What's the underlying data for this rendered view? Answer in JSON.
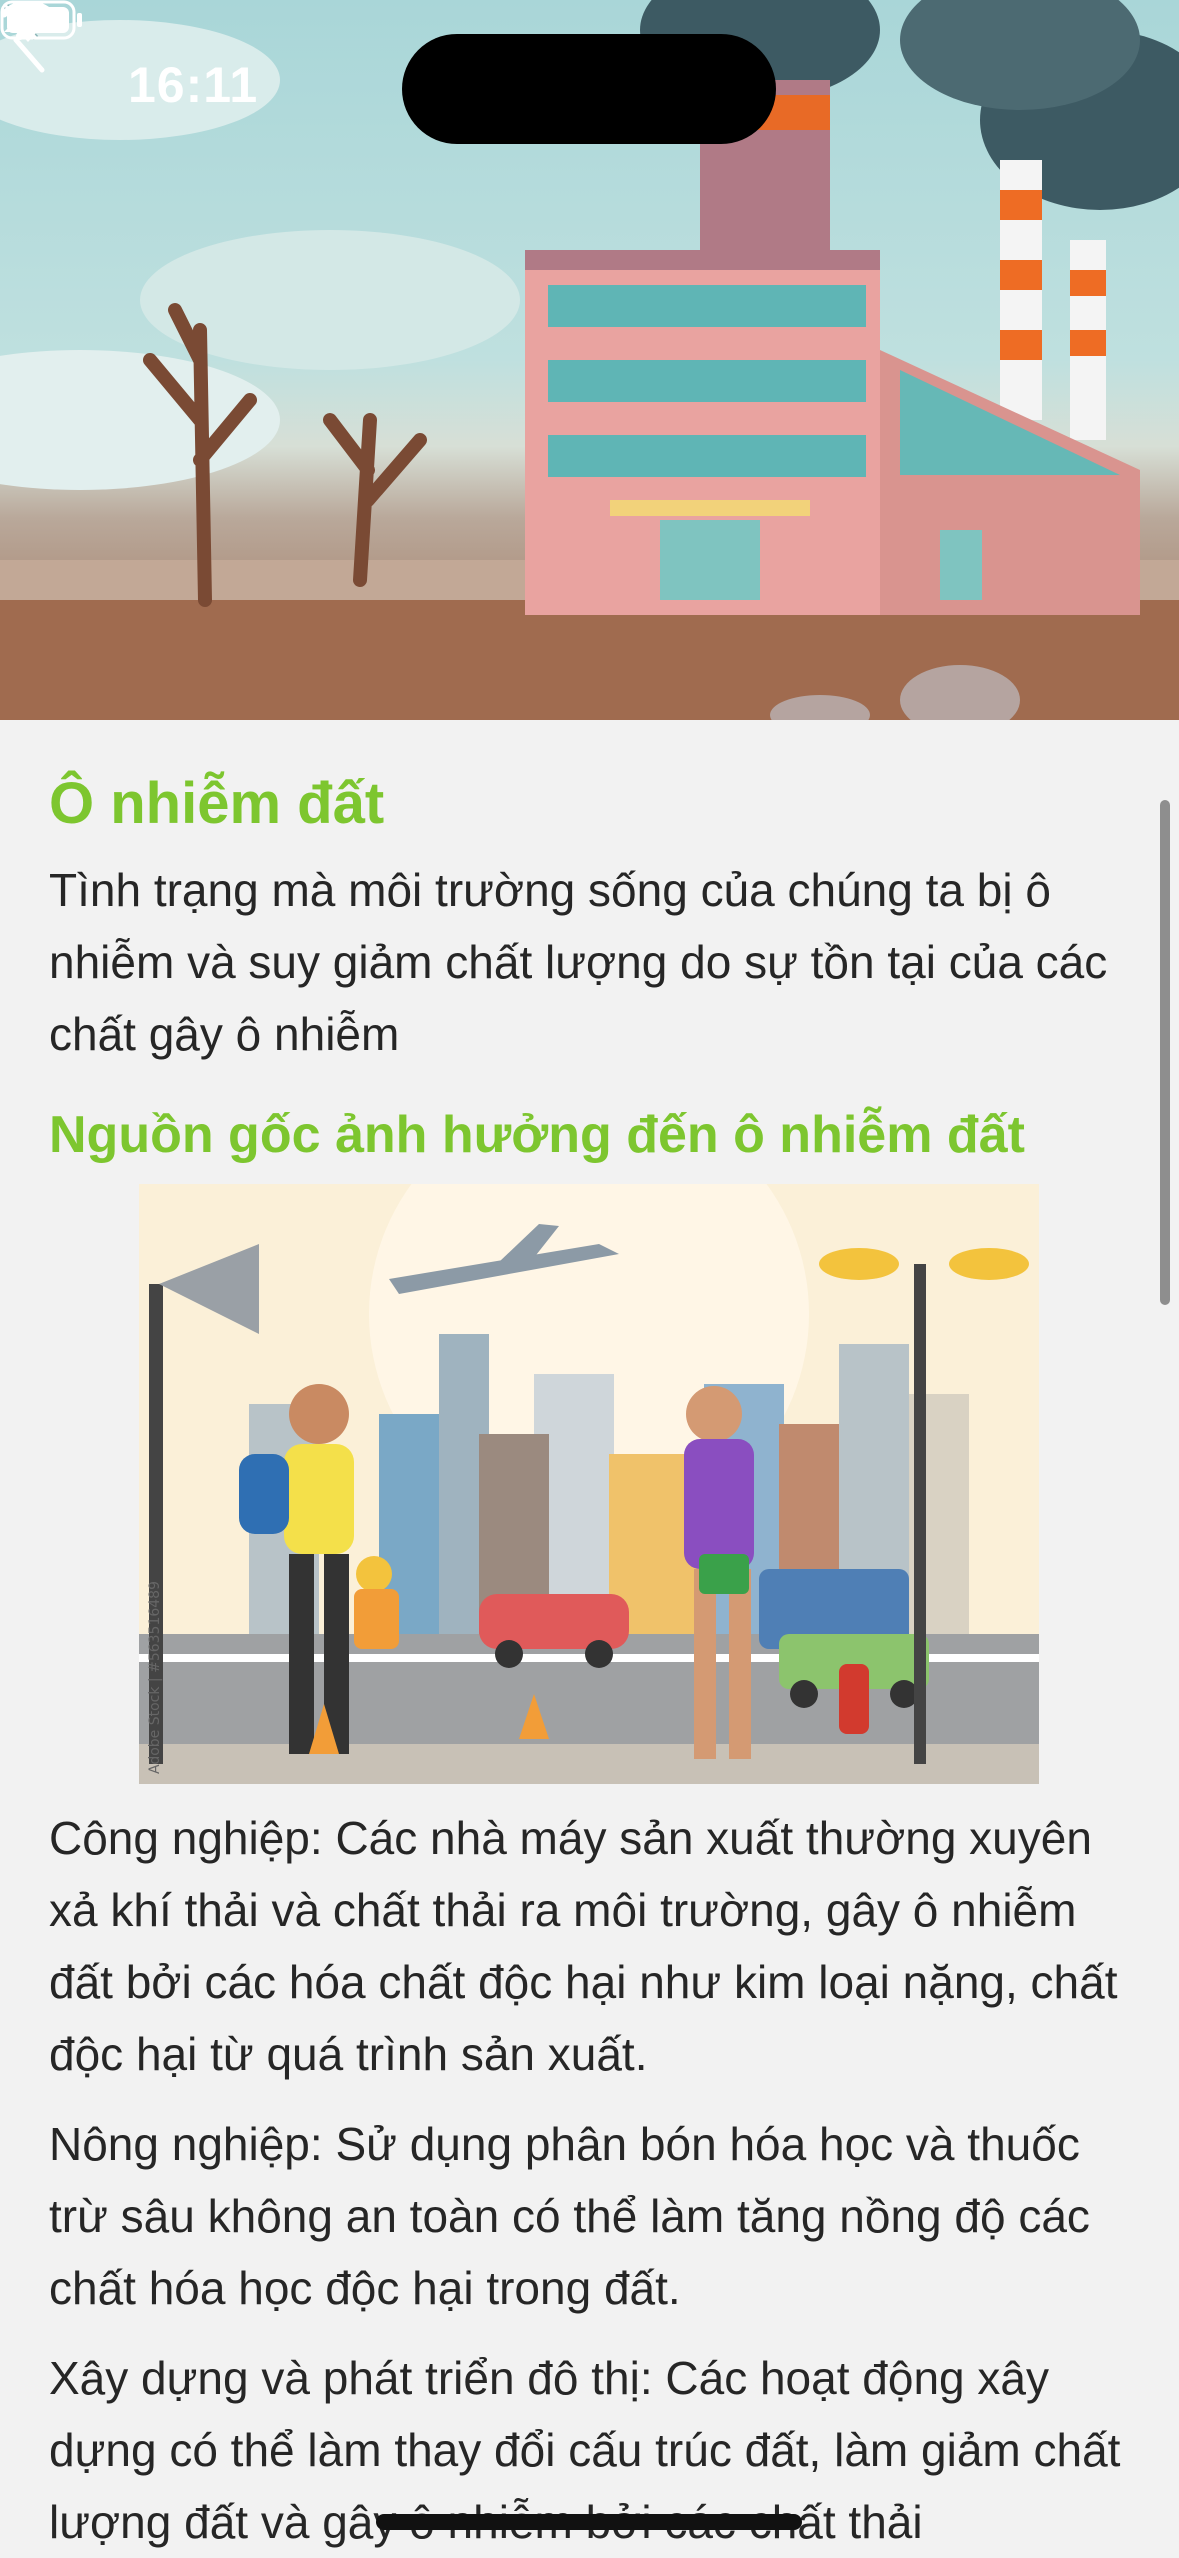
{
  "status_bar": {
    "time": "16:11"
  },
  "article": {
    "title": "Ô nhiễm đất",
    "intro": "Tình trạng mà môi trường sống của chúng ta bị ô nhiễm và suy giảm chất lượng do sự tồn tại của các chất gây ô nhiễm",
    "section_title": "Nguồn gốc ảnh hưởng đến ô nhiễm đất",
    "paragraphs": [
      "Công nghiệp: Các nhà máy sản xuất thường xuyên xả khí thải và chất thải ra môi trường, gây ô nhiễm đất bởi các hóa chất độc hại như kim loại nặng, chất độc hại từ quá trình sản xuất.",
      "Nông nghiệp: Sử dụng phân bón hóa học và thuốc trừ sâu không an toàn có thể làm tăng nồng độ các chất hóa học độc hại trong đất.",
      "Xây dựng và phát triển đô thị: Các hoạt động xây dựng có thể làm thay đổi cấu trúc đất, làm giảm chất lượng đất và gây ô nhiễm bởi các chất thải"
    ],
    "illustration_watermark": "Adobe Stock | #563516489"
  },
  "icons": {
    "back": "chevron-left-icon",
    "mute": "bell-slash-icon",
    "wifi": "wifi-icon",
    "battery": "battery-icon"
  },
  "colors": {
    "heading": "#7dc62f",
    "text": "#262626",
    "background": "#f2f2f2"
  }
}
